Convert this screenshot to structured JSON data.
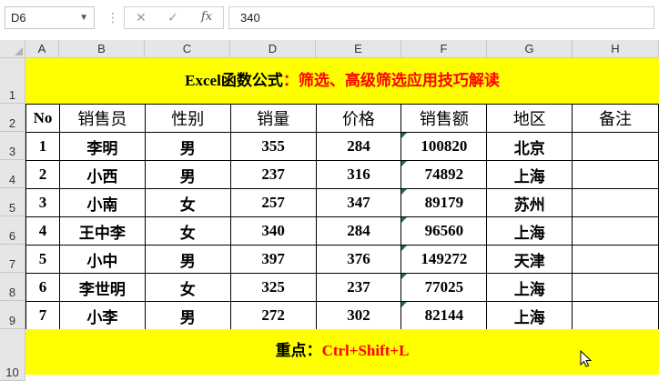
{
  "formula_bar": {
    "cell_ref": "D6",
    "dots": "⋮",
    "cancel_glyph": "✕",
    "confirm_glyph": "✓",
    "fx_glyph": "fx",
    "value": "340"
  },
  "columns": [
    "A",
    "B",
    "C",
    "D",
    "E",
    "F",
    "G",
    "H"
  ],
  "rows": [
    "1",
    "2",
    "3",
    "4",
    "5",
    "6",
    "7",
    "8",
    "9",
    "10"
  ],
  "title": {
    "part1": "Excel函数公式",
    "part2": "：筛选、高级筛选应用技巧解读",
    "part1_color": "#000000",
    "part2_color": "#ff0000"
  },
  "table": {
    "headers": [
      "No",
      "销售员",
      "性别",
      "销量",
      "价格",
      "销售额",
      "地区",
      "备注"
    ],
    "rows": [
      [
        "1",
        "李明",
        "男",
        "355",
        "284",
        "100820",
        "北京",
        ""
      ],
      [
        "2",
        "小西",
        "男",
        "237",
        "316",
        "74892",
        "上海",
        ""
      ],
      [
        "3",
        "小南",
        "女",
        "257",
        "347",
        "89179",
        "苏州",
        ""
      ],
      [
        "4",
        "王中李",
        "女",
        "340",
        "284",
        "96560",
        "上海",
        ""
      ],
      [
        "5",
        "小中",
        "男",
        "397",
        "376",
        "149272",
        "天津",
        ""
      ],
      [
        "6",
        "李世明",
        "女",
        "325",
        "237",
        "77025",
        "上海",
        ""
      ],
      [
        "7",
        "小李",
        "男",
        "272",
        "302",
        "82144",
        "上海",
        ""
      ]
    ]
  },
  "footer": {
    "label": "重点：",
    "shortcut": "Ctrl+Shift+L",
    "label_color": "#000000",
    "shortcut_color": "#ff0000"
  },
  "colors": {
    "band": "#ffff00",
    "header_bg": "#e6e6e6",
    "indicator": "#217346"
  }
}
